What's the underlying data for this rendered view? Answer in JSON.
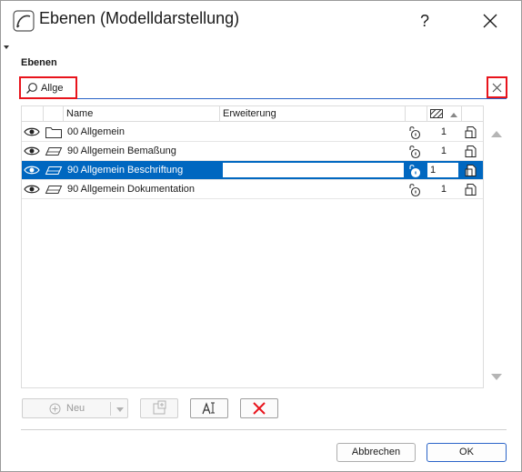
{
  "window": {
    "title": "Ebenen (Modelldarstellung)",
    "help_label": "?"
  },
  "section": {
    "label": "Ebenen"
  },
  "search": {
    "value": "Allge",
    "placeholder": ""
  },
  "table": {
    "columns": {
      "name": "Name",
      "extension": "Erweiterung"
    },
    "rows": [
      {
        "icon": "folder-icon",
        "name": "00 Allgemein",
        "number": "1",
        "selected": false
      },
      {
        "icon": "layer-icon",
        "name": "90 Allgemein Bemaßung",
        "number": "1",
        "selected": false
      },
      {
        "icon": "layer-icon",
        "name": "90 Allgemein Beschriftung",
        "number": "1",
        "selected": true
      },
      {
        "icon": "layer-icon",
        "name": "90 Allgemein Dokumentation",
        "number": "1",
        "selected": false
      }
    ]
  },
  "toolbar": {
    "new_label": "Neu"
  },
  "buttons": {
    "cancel_label": "Abbrechen",
    "ok_label": "OK"
  },
  "colors": {
    "selection": "#0067c0",
    "highlight_box": "#e8141c",
    "focus": "#2a64c8"
  }
}
